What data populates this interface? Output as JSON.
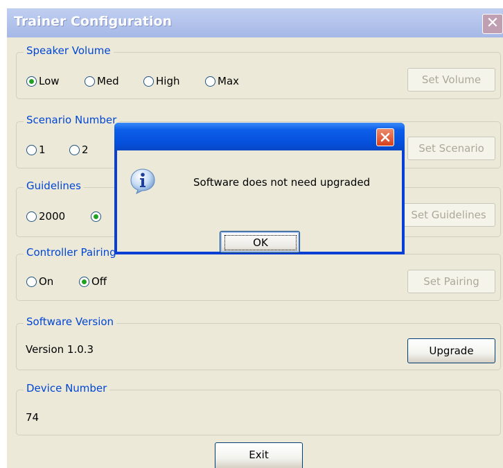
{
  "window": {
    "title": "Trainer Configuration",
    "close_glyph": "✕"
  },
  "speaker_volume": {
    "legend": "Speaker Volume",
    "options": [
      {
        "label": "Low",
        "checked": true
      },
      {
        "label": "Med",
        "checked": false
      },
      {
        "label": "High",
        "checked": false
      },
      {
        "label": "Max",
        "checked": false
      }
    ],
    "button": "Set Volume"
  },
  "scenario": {
    "legend": "Scenario Number",
    "options": [
      {
        "label": "1"
      },
      {
        "label": "2"
      }
    ],
    "button": "Set Scenario"
  },
  "guidelines": {
    "legend": "Guidelines",
    "options": [
      {
        "label": "2000",
        "checked": false
      },
      {
        "label": "",
        "checked": true
      }
    ],
    "button": "Set Guidelines"
  },
  "controller_pairing": {
    "legend": "Controller Pairing",
    "options": [
      {
        "label": "On",
        "checked": false
      },
      {
        "label": "Off",
        "checked": true
      }
    ],
    "button": "Set Pairing"
  },
  "software_version": {
    "legend": "Software Version",
    "value": "Version 1.0.3",
    "button": "Upgrade"
  },
  "device_number": {
    "legend": "Device Number",
    "value": "74"
  },
  "exit_button": "Exit",
  "message_box": {
    "icon": "info-icon",
    "message": "Software does not need upgraded",
    "ok": "OK",
    "close_icon": "close-icon"
  },
  "colors": {
    "legend_blue": "#0046d5",
    "radio_green": "#21a121",
    "dialog_blue": "#0550dd",
    "close_red": "#d6401c"
  }
}
